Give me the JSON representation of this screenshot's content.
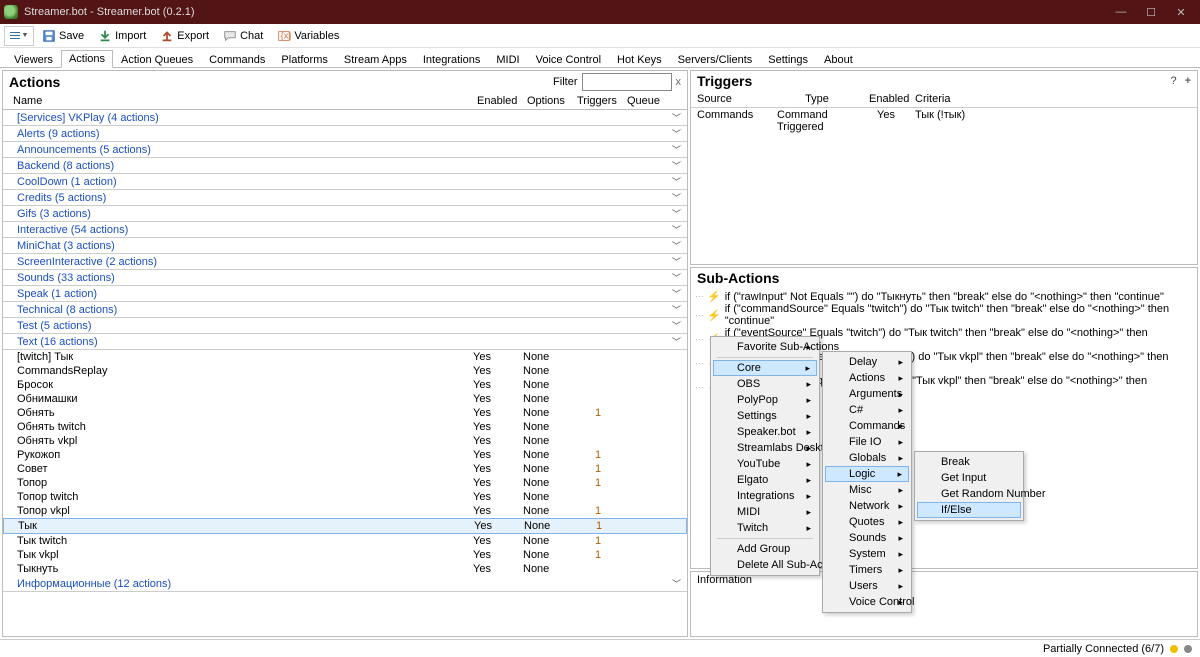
{
  "title": "Streamer.bot - Streamer.bot (0.2.1)",
  "toolbar": {
    "save": "Save",
    "import": "Import",
    "export": "Export",
    "chat": "Chat",
    "vars": "Variables"
  },
  "tabs": [
    "Viewers",
    "Actions",
    "Action Queues",
    "Commands",
    "Platforms",
    "Stream Apps",
    "Integrations",
    "MIDI",
    "Voice Control",
    "Hot Keys",
    "Servers/Clients",
    "Settings",
    "About"
  ],
  "active_tab": "Actions",
  "actions": {
    "title": "Actions",
    "filter_label": "Filter",
    "cols": {
      "name": "Name",
      "enabled": "Enabled",
      "options": "Options",
      "triggers": "Triggers",
      "queue": "Queue"
    },
    "groups": [
      "[Services] VKPlay (4 actions)",
      "Alerts (9 actions)",
      "Announcements (5 actions)",
      "Backend (8 actions)",
      "CoolDown (1 action)",
      "Credits (5 actions)",
      "Gifs (3 actions)",
      "Interactive (54 actions)",
      "MiniChat (3 actions)",
      "ScreenInteractive (2 actions)",
      "Sounds (33 actions)",
      "Speak (1 action)",
      "Technical (8 actions)",
      "Test (5 actions)",
      "Text (16 actions)"
    ],
    "rows": [
      {
        "n": "[twitch] Тык",
        "en": "Yes",
        "op": "None",
        "tr": "",
        "sel": false
      },
      {
        "n": "CommandsReplay",
        "en": "Yes",
        "op": "None",
        "tr": "",
        "sel": false
      },
      {
        "n": "Бросок",
        "en": "Yes",
        "op": "None",
        "tr": "",
        "sel": false
      },
      {
        "n": "Обнимашки",
        "en": "Yes",
        "op": "None",
        "tr": "",
        "sel": false
      },
      {
        "n": "Обнять",
        "en": "Yes",
        "op": "None",
        "tr": "1",
        "sel": false
      },
      {
        "n": "Обнять twitch",
        "en": "Yes",
        "op": "None",
        "tr": "",
        "sel": false
      },
      {
        "n": "Обнять vkpl",
        "en": "Yes",
        "op": "None",
        "tr": "",
        "sel": false
      },
      {
        "n": "Рукожоп",
        "en": "Yes",
        "op": "None",
        "tr": "1",
        "sel": false
      },
      {
        "n": "Совет",
        "en": "Yes",
        "op": "None",
        "tr": "1",
        "sel": false
      },
      {
        "n": "Топор",
        "en": "Yes",
        "op": "None",
        "tr": "1",
        "sel": false
      },
      {
        "n": "Топор twitch",
        "en": "Yes",
        "op": "None",
        "tr": "",
        "sel": false
      },
      {
        "n": "Топор vkpl",
        "en": "Yes",
        "op": "None",
        "tr": "1",
        "sel": false
      },
      {
        "n": "Тык",
        "en": "Yes",
        "op": "None",
        "tr": "1",
        "sel": true
      },
      {
        "n": "Тык twitch",
        "en": "Yes",
        "op": "None",
        "tr": "1",
        "sel": false
      },
      {
        "n": "Тык vkpl",
        "en": "Yes",
        "op": "None",
        "tr": "1",
        "sel": false
      },
      {
        "n": "Тыкнуть",
        "en": "Yes",
        "op": "None",
        "tr": "",
        "sel": false
      }
    ],
    "last_group": "Информационные (12 actions)"
  },
  "triggers": {
    "title": "Triggers",
    "cols": {
      "src": "Source",
      "type": "Type",
      "en": "Enabled",
      "crit": "Criteria"
    },
    "row": {
      "src": "Commands",
      "type": "Command Triggered",
      "en": "Yes",
      "crit": "Тык (!тык)"
    }
  },
  "sub": {
    "title": "Sub-Actions",
    "items": [
      "if (\"rawInput\" Not Equals \"\") do \"Тыкнуть\" then \"break\" else do \"<nothing>\" then \"continue\"",
      "if (\"commandSource\" Equals \"twitch\") do \"Тык twitch\" then \"break\" else do \"<nothing>\" then \"continue\"",
      "if (\"eventSource\" Equals \"twitch\") do \"Тык twitch\" then \"break\" else do \"<nothing>\" then \"continue\"",
      "if (\"commandSource\" Equals \"VKPlay\") do \"Тык vkpl\" then \"break\" else do \"<nothing>\" then \"continue\"",
      "if (\"eventSource\" Equals \"VKPlay\") do \"Тык vkpl\" then \"break\" else do \"<nothing>\" then \"continue\""
    ]
  },
  "info": {
    "title": "Information"
  },
  "ctx1": {
    "fav": "Favorite Sub-Actions",
    "items": [
      "Core",
      "OBS",
      "PolyPop",
      "Settings",
      "Speaker.bot",
      "Streamlabs Desktop",
      "YouTube",
      "Elgato",
      "Integrations",
      "MIDI",
      "Twitch"
    ],
    "sep_after": "Twitch",
    "extra": [
      "Add Group",
      "Delete All Sub-Actions"
    ],
    "selected": "Core"
  },
  "ctx2": {
    "items": [
      "Delay",
      "Actions",
      "Arguments",
      "C#",
      "Commands",
      "File IO",
      "Globals",
      "Logic",
      "Misc",
      "Network",
      "Quotes",
      "Sounds",
      "System",
      "Timers",
      "Users",
      "Voice Control"
    ],
    "selected": "Logic"
  },
  "ctx3": {
    "items": [
      "Break",
      "Get Input",
      "Get Random Number",
      "If/Else"
    ],
    "selected": "If/Else"
  },
  "status": {
    "text": "Partially Connected (6/7)",
    "dot1": "#f0c000",
    "dot2": "#888"
  }
}
